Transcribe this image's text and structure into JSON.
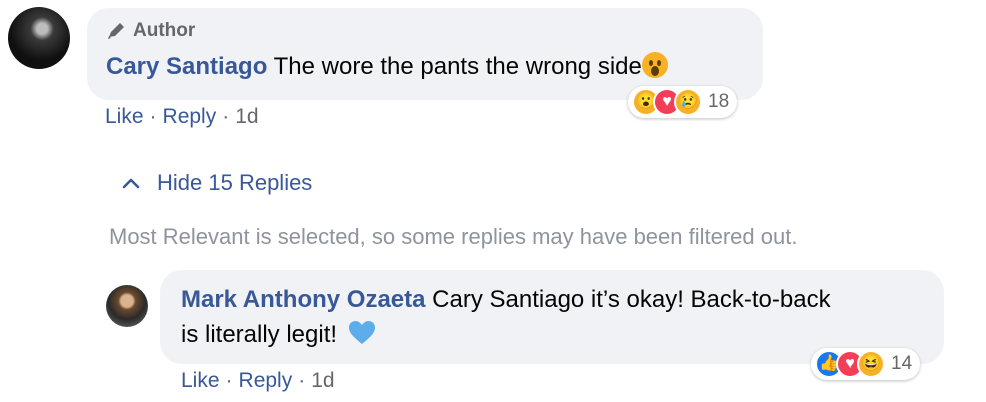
{
  "comment": {
    "badge": "Author",
    "author": "Cary Santiago",
    "text": "The wore the pants the wrong side",
    "actions": {
      "like": "Like",
      "reply": "Reply",
      "time": "1d",
      "separator": "·"
    },
    "reactions": {
      "icons": [
        "wow-icon",
        "love-icon",
        "sad-icon"
      ],
      "count": "18"
    }
  },
  "replies_toggle": {
    "label": "Hide 15 Replies"
  },
  "filter_notice": "Most Relevant is selected, so some replies may have been filtered out.",
  "reply": {
    "author": "Mark Anthony Ozaeta",
    "text_line1": "Cary Santiago it’s okay! Back-to-back",
    "text_line2": "is literally legit!",
    "actions": {
      "like": "Like",
      "reply": "Reply",
      "time": "1d",
      "separator": "·"
    },
    "reactions": {
      "icons": [
        "like-icon",
        "love-icon",
        "haha-icon"
      ],
      "count": "14"
    }
  },
  "colors": {
    "link": "#385898",
    "bubble": "#f0f2f5",
    "muted": "#65676b",
    "notice": "#8d949e"
  }
}
